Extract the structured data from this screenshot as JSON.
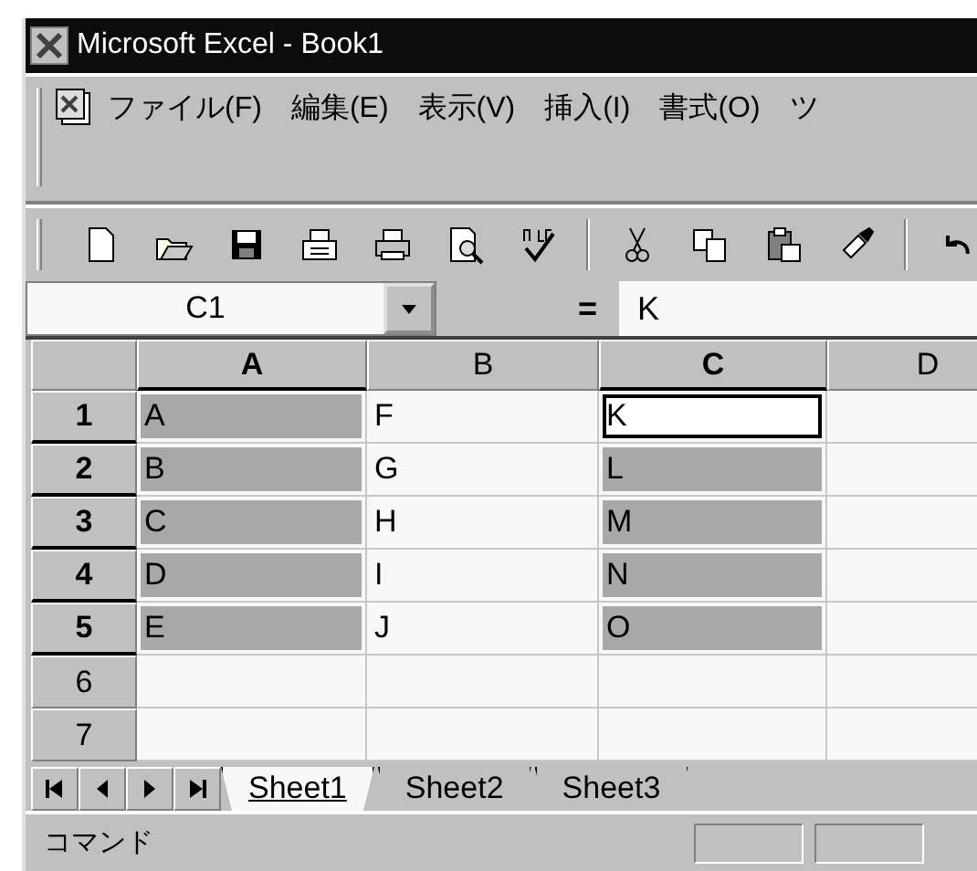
{
  "window": {
    "title": "Microsoft Excel - Book1"
  },
  "menu_bar": {
    "items": [
      "ファイル(F)",
      "編集(E)",
      "表示(V)",
      "挿入(I)",
      "書式(O)",
      "ツ"
    ]
  },
  "name_box": {
    "value": "C1"
  },
  "formula_bar": {
    "equals": "=",
    "value": "K"
  },
  "sheet": {
    "columns": [
      {
        "label": "A",
        "selected": true
      },
      {
        "label": "B",
        "selected": false
      },
      {
        "label": "C",
        "selected": true
      },
      {
        "label": "D",
        "selected": false
      }
    ],
    "rows": [
      {
        "label": "1",
        "selected": true,
        "cells": [
          {
            "value": "A",
            "selected": true,
            "active": false
          },
          {
            "value": "F",
            "selected": false,
            "active": false
          },
          {
            "value": "K",
            "selected": true,
            "active": true
          },
          {
            "selected": false,
            "active": false
          }
        ]
      },
      {
        "label": "2",
        "selected": true,
        "cells": [
          {
            "value": "B",
            "selected": true,
            "active": false
          },
          {
            "value": "G",
            "selected": false,
            "active": false
          },
          {
            "value": "L",
            "selected": true,
            "active": false
          },
          {
            "selected": false,
            "active": false
          }
        ]
      },
      {
        "label": "3",
        "selected": true,
        "cells": [
          {
            "value": "C",
            "selected": true,
            "active": false
          },
          {
            "value": "H",
            "selected": false,
            "active": false
          },
          {
            "value": "M",
            "selected": true,
            "active": false
          },
          {
            "selected": false,
            "active": false
          }
        ]
      },
      {
        "label": "4",
        "selected": true,
        "cells": [
          {
            "value": "D",
            "selected": true,
            "active": false
          },
          {
            "value": "I",
            "selected": false,
            "active": false
          },
          {
            "value": "N",
            "selected": true,
            "active": false
          },
          {
            "selected": false,
            "active": false
          }
        ]
      },
      {
        "label": "5",
        "selected": true,
        "cells": [
          {
            "value": "E",
            "selected": true,
            "active": false
          },
          {
            "value": "J",
            "selected": false,
            "active": false
          },
          {
            "value": "O",
            "selected": true,
            "active": false
          },
          {
            "selected": false,
            "active": false
          }
        ]
      },
      {
        "label": "6",
        "selected": false,
        "cells": [
          {
            "selected": false,
            "active": false
          },
          {
            "selected": false,
            "active": false
          },
          {
            "selected": false,
            "active": false
          },
          {
            "selected": false,
            "active": false
          }
        ]
      },
      {
        "label": "7",
        "selected": false,
        "cells": [
          {
            "selected": false,
            "active": false
          },
          {
            "selected": false,
            "active": false
          },
          {
            "selected": false,
            "active": false
          },
          {
            "selected": false,
            "active": false
          }
        ]
      }
    ]
  },
  "sheet_tabs": [
    {
      "label": "Sheet1",
      "selected": true
    },
    {
      "label": "Sheet2",
      "selected": false
    },
    {
      "label": "Sheet3",
      "selected": false
    }
  ],
  "status_bar": {
    "text": "コマンド"
  }
}
